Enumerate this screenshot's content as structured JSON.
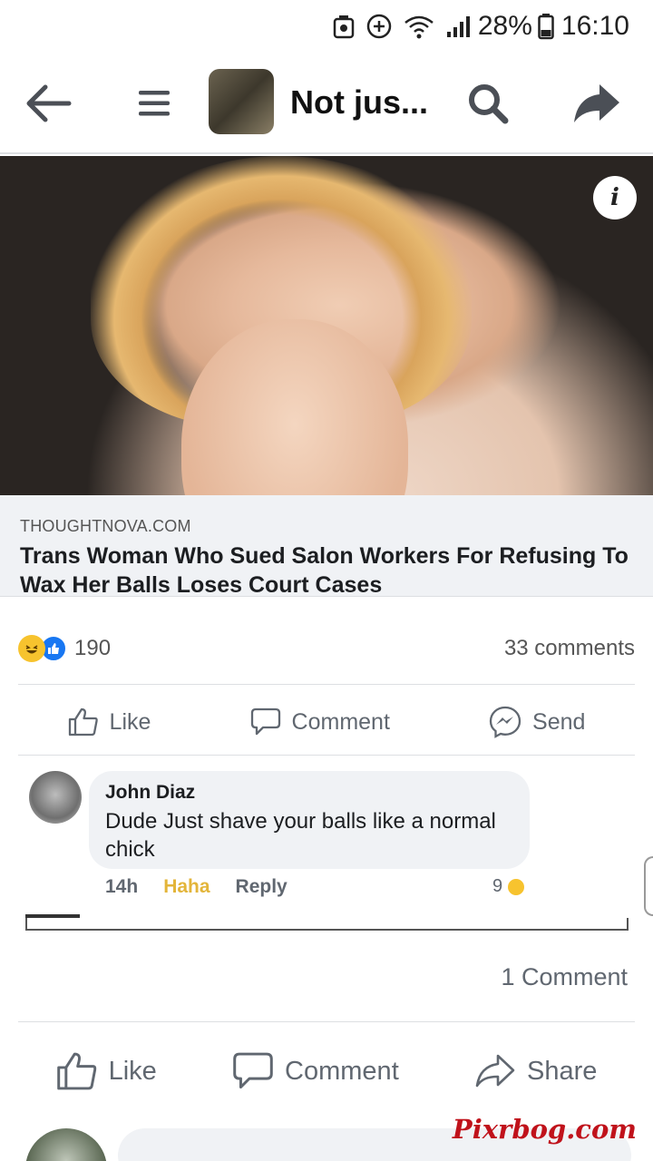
{
  "status_bar": {
    "battery_percent": "28%",
    "time": "16:10"
  },
  "nav": {
    "page_title": "Not jus..."
  },
  "link_preview": {
    "domain": "THOUGHTNOVA.COM",
    "title": "Trans Woman Who Sued Salon Workers For Refusing To Wax Her Balls Loses Court Cases"
  },
  "reactions": {
    "count": "190",
    "comments": "33 comments"
  },
  "actions_small": {
    "like": "Like",
    "comment": "Comment",
    "send": "Send"
  },
  "comment": {
    "author": "John Diaz",
    "text": "Dude  Just shave your balls like a normal chick",
    "time": "14h",
    "haha": "Haha",
    "reply": "Reply",
    "reaction_count": "9"
  },
  "outer_post": {
    "comments": "1 Comment",
    "like": "Like",
    "comment": "Comment",
    "share": "Share"
  },
  "watermark": "Pixrbog.com"
}
